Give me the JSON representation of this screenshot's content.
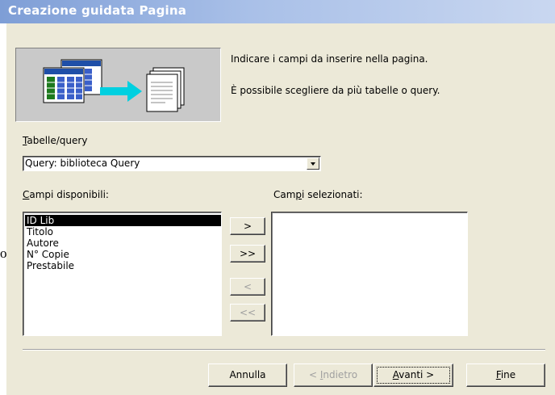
{
  "window": {
    "title": "Creazione guidata Pagina"
  },
  "outside_text": "o",
  "wizard": {
    "description_line1": "Indicare i campi da inserire nella pagina.",
    "description_line2": "È possibile scegliere da più tabelle o query.",
    "table_query": {
      "label_mnemonic": "T",
      "label_rest": "abelle/query",
      "selected": "Query: biblioteca Query"
    },
    "available": {
      "label_mnemonic": "C",
      "label_rest": "ampi disponibili:",
      "items": [
        "ID Lib",
        "Titolo",
        "Autore",
        "N° Copie",
        "Prestabile"
      ],
      "selected_index": 0
    },
    "selected_fields": {
      "label_pre": "Cam",
      "label_mnemonic": "p",
      "label_rest": "i selezionati:",
      "items": []
    },
    "move_buttons": {
      "add_one": ">",
      "add_all": ">>",
      "remove_one": "<",
      "remove_all": "<<"
    }
  },
  "footer": {
    "cancel": "Annulla",
    "back_pre": "< ",
    "back_mnemonic": "I",
    "back_rest": "ndietro",
    "next_mnemonic": "A",
    "next_rest": "vanti >",
    "finish_mnemonic": "F",
    "finish_rest": "ine"
  },
  "colors": {
    "titlebar_start": "#7e9ed6",
    "titlebar_end": "#c9d7f0",
    "dialog_bg": "#ece9d8",
    "selection": "#000000"
  }
}
